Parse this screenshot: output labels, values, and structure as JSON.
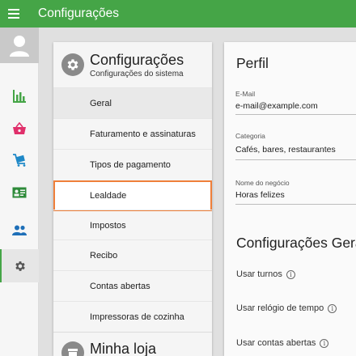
{
  "app": {
    "title": "Configurações"
  },
  "rail": {
    "items": [
      {
        "icon": "bar-chart-icon",
        "color": "#45a547"
      },
      {
        "icon": "basket-icon",
        "color": "#e0306b"
      },
      {
        "icon": "cart-icon",
        "color": "#1e88c7"
      },
      {
        "icon": "id-card-icon",
        "color": "#2e8b3a"
      },
      {
        "icon": "people-icon",
        "color": "#1e6fb8"
      },
      {
        "icon": "gear-icon",
        "color": "#555555",
        "active": true
      }
    ]
  },
  "sidebar": {
    "section_title": "Configurações",
    "section_subtitle": "Configurações do sistema",
    "items": [
      {
        "label": "Geral"
      },
      {
        "label": "Faturamento e assinaturas"
      },
      {
        "label": "Tipos de pagamento"
      },
      {
        "label": "Lealdade"
      },
      {
        "label": "Impostos"
      },
      {
        "label": "Recibo"
      },
      {
        "label": "Contas abertas"
      },
      {
        "label": "Impressoras de cozinha"
      }
    ],
    "selected_item": "Geral",
    "highlighted_item": "Lealdade",
    "next_section_title": "Minha loja"
  },
  "content": {
    "profile_title": "Perfil",
    "email": {
      "label": "E-Mail",
      "value": "e-mail@example.com"
    },
    "category": {
      "label": "Categoria",
      "value": "Cafés, bares, restaurantes"
    },
    "business_name": {
      "label": "Nome do negócio",
      "value": "Horas felizes"
    },
    "settings_title": "Configurações Gerais",
    "toggles": [
      {
        "label": "Usar turnos"
      },
      {
        "label": "Usar relógio de tempo"
      },
      {
        "label": "Usar contas abertas"
      }
    ]
  },
  "colors": {
    "appbar": "#45a547",
    "highlight_border": "#ef7f3a"
  }
}
